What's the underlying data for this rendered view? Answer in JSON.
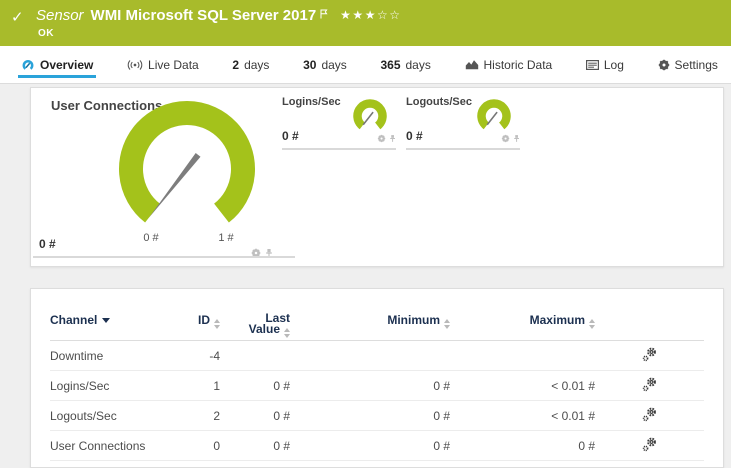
{
  "colors": {
    "brand_green": "#a8bb2b",
    "gauge_green": "#a4c21b",
    "accent_blue": "#2aa3da",
    "table_header_navy": "#1c3050"
  },
  "header": {
    "status_icon": "check-icon",
    "check_glyph": "✓",
    "kind_label": "Sensor",
    "title": "WMI Microsoft SQL Server 2017",
    "flag_icon": "flag-icon",
    "stars_filled": "★★★",
    "stars_empty": "☆☆",
    "status": "OK"
  },
  "tabs": {
    "overview": {
      "label": "Overview",
      "icon": "gauge-icon",
      "active": true
    },
    "live": {
      "label": "Live Data",
      "icon": "live-signal-icon"
    },
    "d2": {
      "num": "2",
      "label": "days"
    },
    "d30": {
      "num": "30",
      "label": "days"
    },
    "d365": {
      "num": "365",
      "label": "days"
    },
    "historic": {
      "label": "Historic Data",
      "icon": "area-chart-icon"
    },
    "log": {
      "label": "Log",
      "icon": "log-list-icon"
    },
    "settings": {
      "label": "Settings",
      "icon": "gear-icon"
    }
  },
  "gauges": {
    "main": {
      "title": "User Connections",
      "value": "0 #",
      "scale_min": "0 #",
      "scale_max": "1 #",
      "controls": [
        "gear-icon",
        "pin-icon"
      ]
    },
    "logins": {
      "title": "Logins/Sec",
      "value": "0 #",
      "controls": [
        "gear-icon",
        "pin-icon"
      ]
    },
    "logouts": {
      "title": "Logouts/Sec",
      "value": "0 #",
      "controls": [
        "gear-icon",
        "pin-icon"
      ]
    }
  },
  "table": {
    "headers": {
      "channel": "Channel",
      "id": "ID",
      "last_line1": "Last",
      "last_line2": "Value",
      "minimum": "Minimum",
      "maximum": "Maximum"
    },
    "row_action_icon": "channel-settings-gears-icon",
    "rows": [
      {
        "channel": "Downtime",
        "id": "-4",
        "last": "",
        "min": "",
        "max": ""
      },
      {
        "channel": "Logins/Sec",
        "id": "1",
        "last": "0 #",
        "min": "0 #",
        "max": "< 0.01 #"
      },
      {
        "channel": "Logouts/Sec",
        "id": "2",
        "last": "0 #",
        "min": "0 #",
        "max": "< 0.01 #"
      },
      {
        "channel": "User Connections",
        "id": "0",
        "last": "0 #",
        "min": "0 #",
        "max": "0 #"
      }
    ]
  }
}
